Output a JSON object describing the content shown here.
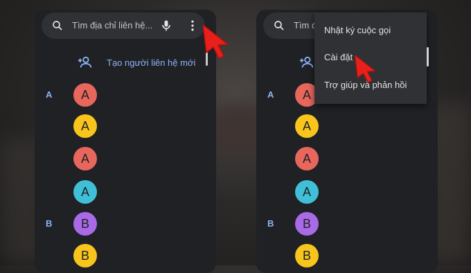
{
  "left_panel": {
    "search_placeholder": "Tìm địa chỉ liên hệ...",
    "create_contact_label": "Tạo người liên hệ mới"
  },
  "right_panel": {
    "search_placeholder": "Tìm địa chỉ liên hệ...",
    "menu": {
      "items": [
        "Nhật ký cuộc gọi",
        "Cài đặt",
        "Trợ giúp và phản hồi"
      ]
    }
  },
  "contacts": [
    {
      "letter": "A",
      "initial": "A",
      "color": "#e8675d"
    },
    {
      "letter": "",
      "initial": "A",
      "color": "#f8c51c"
    },
    {
      "letter": "",
      "initial": "A",
      "color": "#e8675d"
    },
    {
      "letter": "",
      "initial": "A",
      "color": "#3fc0d8"
    },
    {
      "letter": "B",
      "initial": "B",
      "color": "#a96ae8"
    },
    {
      "letter": "",
      "initial": "B",
      "color": "#f8c51c"
    }
  ],
  "icons": [
    "search-icon",
    "mic-icon",
    "more-vert-icon",
    "add-person-icon",
    "cursor-arrow-icon"
  ],
  "colors": {
    "accent": "#8ab4f8",
    "panel_bg": "#202124",
    "search_bg": "#303134",
    "cursor": "#e8201c"
  }
}
